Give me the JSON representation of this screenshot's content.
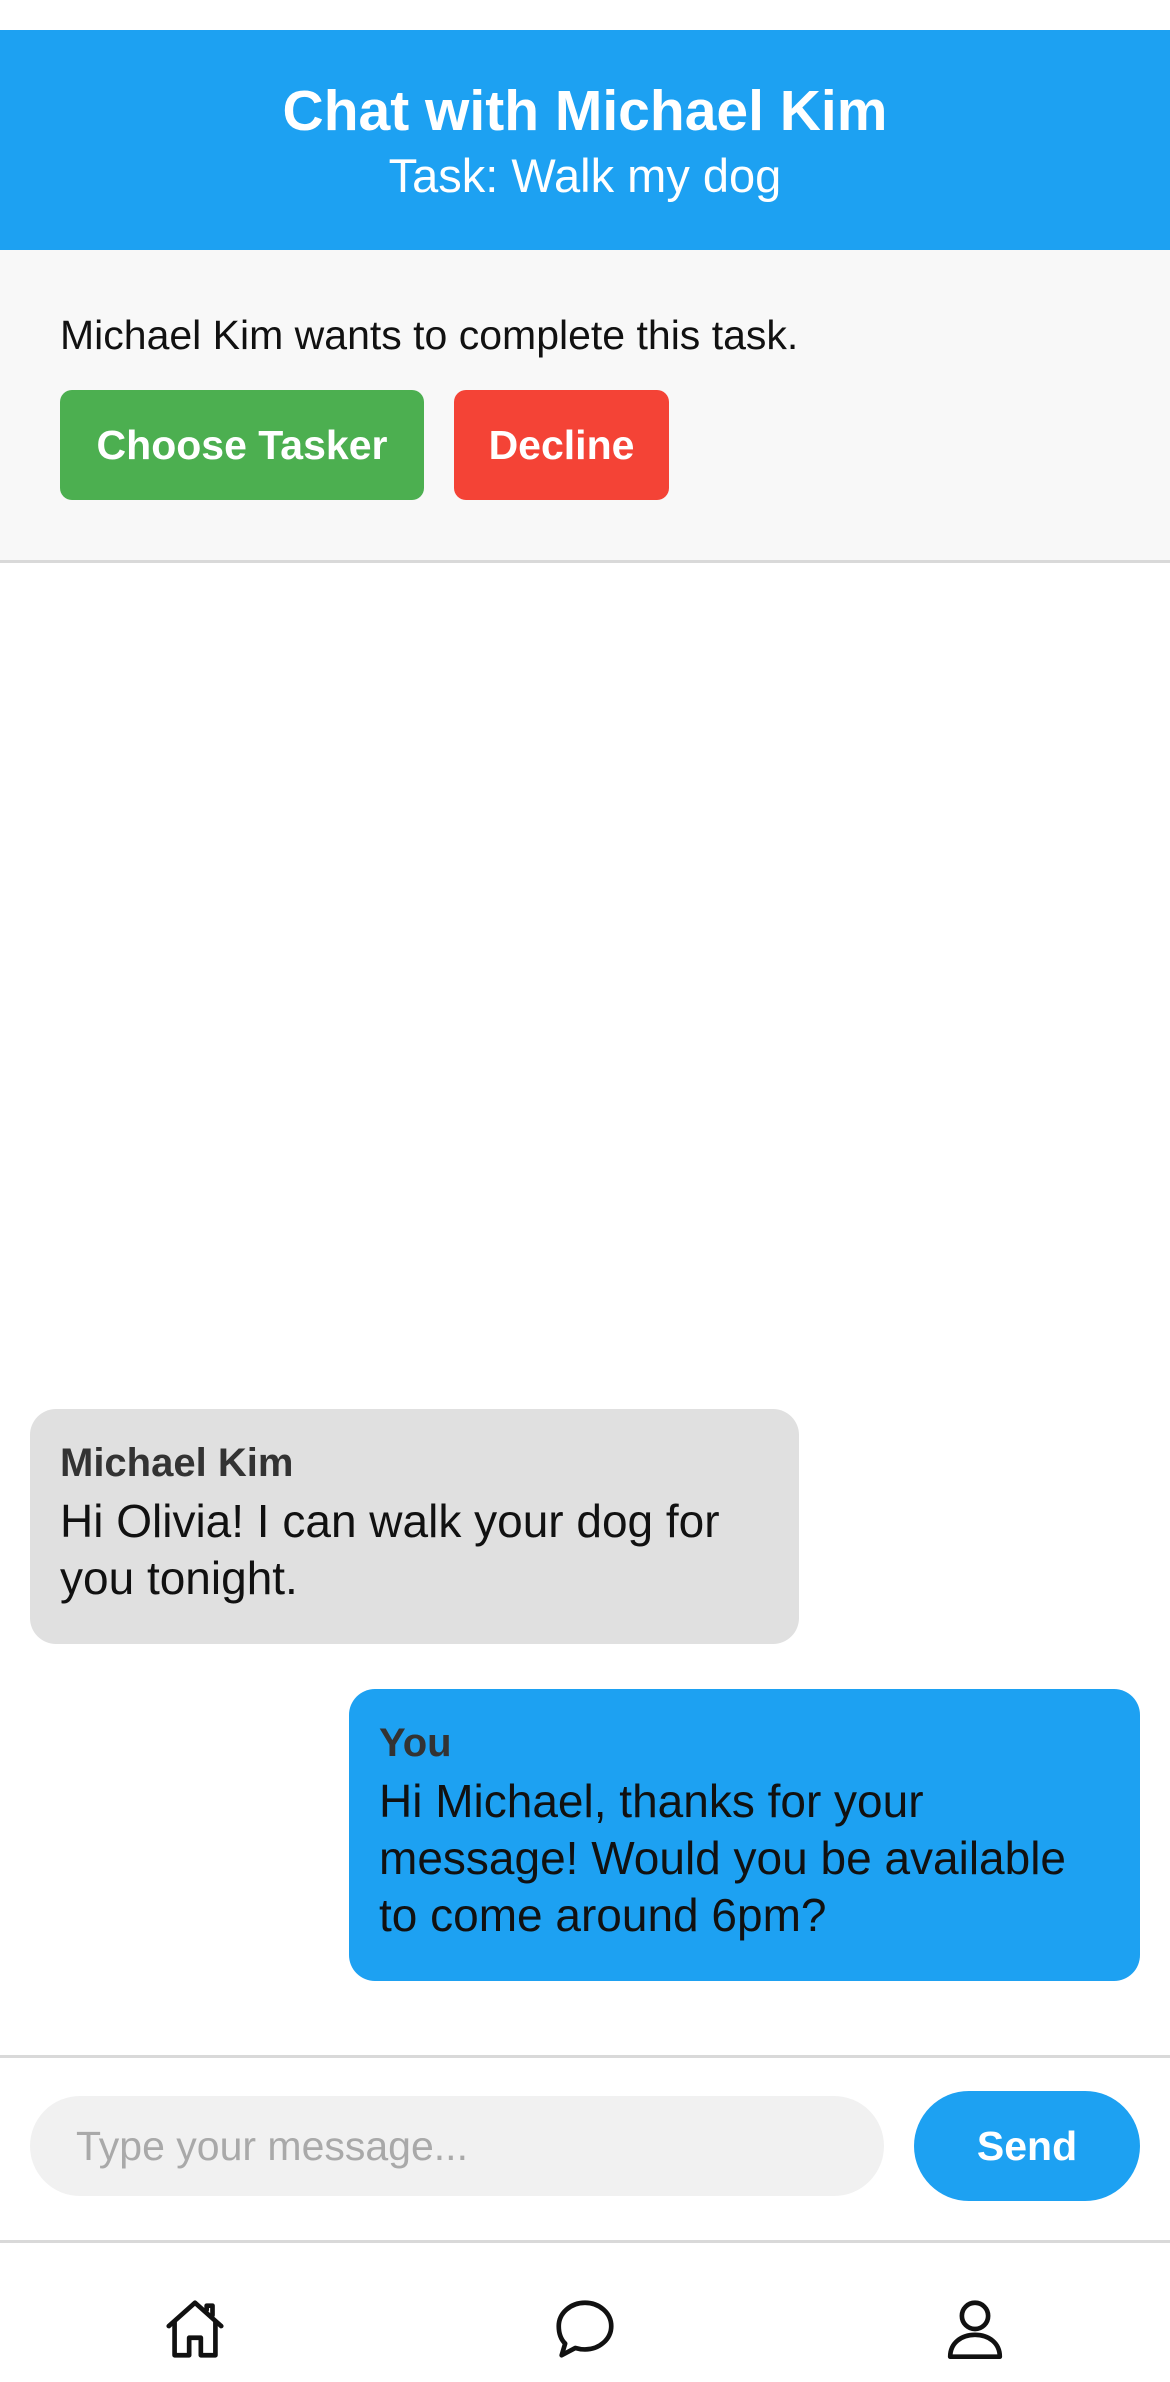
{
  "header": {
    "title": "Chat with Michael Kim",
    "subtitle": "Task: Walk my dog"
  },
  "offer": {
    "text": "Michael Kim wants to complete this task.",
    "choose_label": "Choose Tasker",
    "decline_label": "Decline"
  },
  "messages": [
    {
      "sender": "Michael Kim",
      "text": "Hi Olivia! I can walk your dog for you tonight.",
      "direction": "incoming"
    },
    {
      "sender": "You",
      "text": "Hi Michael, thanks for your message! Would you be available to come around 6pm?",
      "direction": "outgoing"
    }
  ],
  "composer": {
    "placeholder": "Type your message...",
    "value": "",
    "send_label": "Send"
  },
  "tabbar": {
    "tabs": [
      "home-icon",
      "chat-icon",
      "profile-icon"
    ]
  },
  "colors": {
    "brand_blue": "#1da1f2",
    "accept_green": "#4caf50",
    "decline_red": "#f44336",
    "incoming_bubble": "#e0e0e0"
  }
}
